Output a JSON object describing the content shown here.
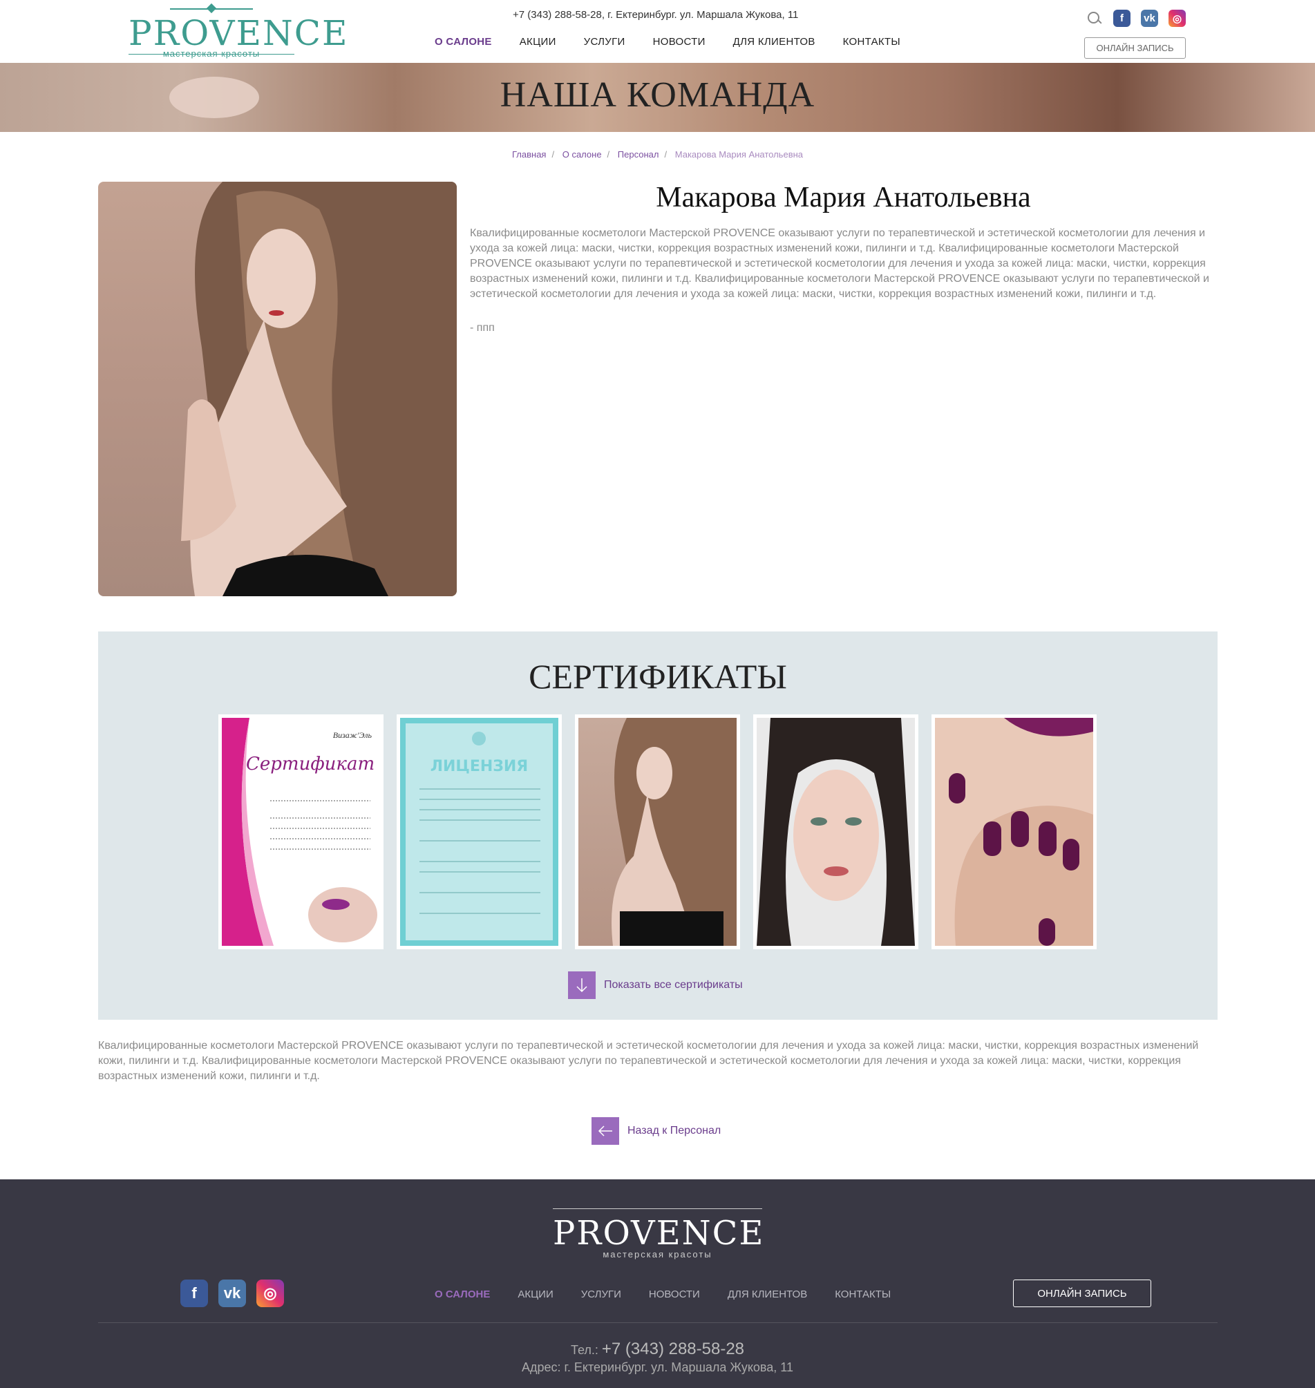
{
  "header": {
    "logo_text": "PROVENCE",
    "logo_sub": "мастерская красоты",
    "contact": "+7 (343) 288-58-28, г. Ектеринбург. ул. Маршала Жукова, 11",
    "nav": [
      "О САЛОНЕ",
      "АКЦИИ",
      "УСЛУГИ",
      "НОВОСТИ",
      "ДЛЯ КЛИЕНТОВ",
      "КОНТАКТЫ"
    ],
    "online_button": "ОНЛАЙН ЗАПИСЬ",
    "social_icons": [
      "search-icon",
      "facebook-icon",
      "vk-icon",
      "instagram-icon"
    ]
  },
  "hero": {
    "title": "НАША КОМАНДА"
  },
  "breadcrumb": {
    "items": [
      "Главная",
      "О салоне",
      "Персонал"
    ],
    "current": "Макарова Мария Анатольевна"
  },
  "profile": {
    "name": "Макарова Мария Анатольевна",
    "bio": "Квалифицированные косметологи Мастерской PROVENCE оказывают услуги по терапевтической и эстетической косметологии для лечения и ухода за кожей лица: маски, чистки, коррекция возрастных изменений кожи, пилинги и т.д. Квалифицированные косметологи Мастерской PROVENCE оказывают услуги по терапевтической и эстетической косметологии для лечения и ухода за кожей лица: маски, чистки, коррекция возрастных изменений кожи, пилинги и т.д. Квалифицированные косметологи Мастерской PROVENCE оказывают услуги по терапевтической и эстетической косметологии для лечения и ухода за кожей лица: маски, чистки, коррекция возрастных изменений кожи, пилинги и т.д.",
    "extra": "- ппп"
  },
  "certificates": {
    "title": "СЕРТИФИКАТЫ",
    "items": [
      {
        "heading": "Сертификат",
        "studio": "Визаж'Эль"
      },
      {
        "heading": "ЛИЦЕНЗИЯ"
      },
      {},
      {},
      {}
    ],
    "show_all": "Показать все сертификаты"
  },
  "bottom_text": "Квалифицированные косметологи Мастерской PROVENCE оказывают услуги по терапевтической и эстетической косметологии для лечения и ухода за кожей лица: маски, чистки, коррекция возрастных изменений кожи, пилинги и т.д. Квалифицированные косметологи Мастерской PROVENCE оказывают услуги по терапевтической и эстетической косметологии для лечения и ухода за кожей лица: маски, чистки, коррекция возрастных изменений кожи, пилинги и т.д.",
  "back_link": "Назад к Персонал",
  "footer": {
    "logo_text": "PROVENCE",
    "logo_sub": "мастерская красоты",
    "nav": [
      "О САЛОНЕ",
      "АКЦИИ",
      "УСЛУГИ",
      "НОВОСТИ",
      "ДЛЯ КЛИЕНТОВ",
      "КОНТАКТЫ"
    ],
    "online_button": "ОНЛАЙН ЗАПИСЬ",
    "phone_label": "Тел.:",
    "phone": "+7 (343) 288-58-28",
    "address": "Адрес: г. Ектеринбург. ул. Маршала Жукова, 11"
  },
  "colors": {
    "accent": "#6a3c8c",
    "logo_teal": "#3e9c8f",
    "cert_bg": "#dfe7ea",
    "footer_bg": "#393844"
  }
}
